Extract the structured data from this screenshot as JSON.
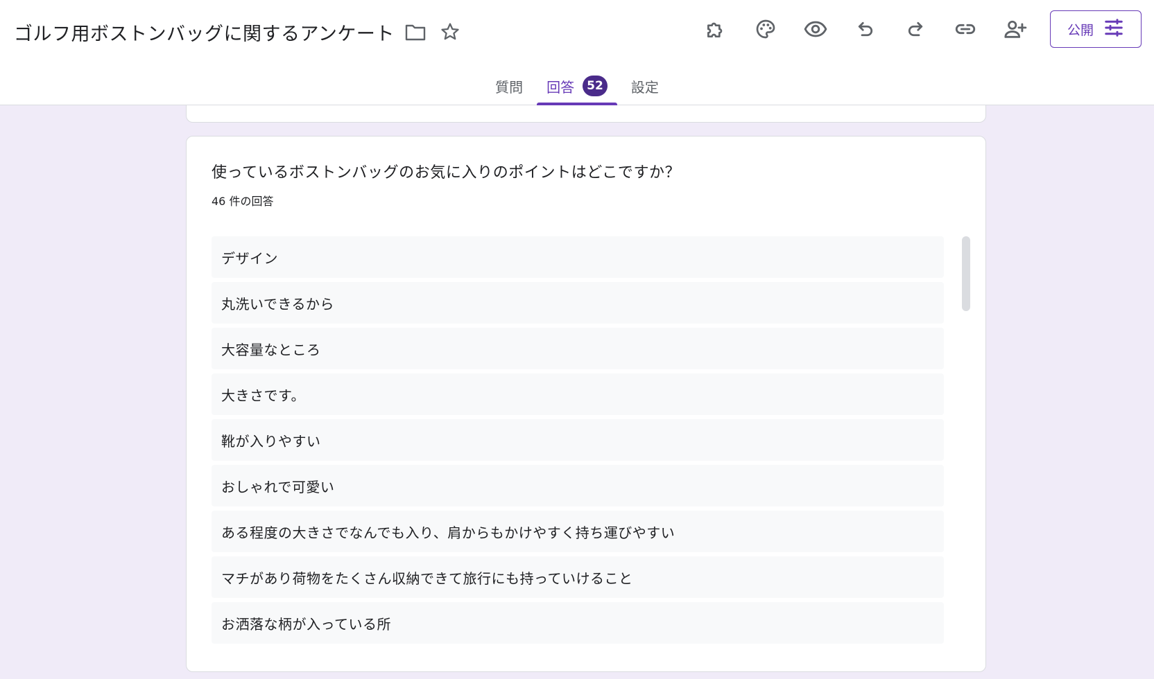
{
  "header": {
    "title": "ゴルフ用ボストンバッグに関するアンケート",
    "icons": {
      "folder": "folder-icon",
      "star": "star-icon"
    },
    "toolbar": [
      "addon-puzzle-icon",
      "palette-icon",
      "preview-eye-icon",
      "undo-icon",
      "redo-icon",
      "link-icon",
      "add-collaborator-icon"
    ],
    "publish_label": "公開",
    "publish_icon": "tune-sliders-icon"
  },
  "tabs": [
    {
      "label": "質問",
      "active": false
    },
    {
      "label": "回答",
      "active": true,
      "badge": "52"
    },
    {
      "label": "設定",
      "active": false
    }
  ],
  "question": {
    "title": "使っているボストンバッグのお気に入りのポイントはどこですか？",
    "count": "46 件の回答",
    "responses": [
      "デザイン",
      "丸洗いできるから",
      "大容量なところ",
      "大きさです。",
      "靴が入りやすい",
      "おしゃれで可愛い",
      "ある程度の大きさでなんでも入り、肩からもかけやすく持ち運びやすい",
      "マチがあり荷物をたくさん収納できて旅行にも持っていけること",
      "お洒落な柄が入っている所"
    ]
  },
  "colors": {
    "accent": "#673ab7",
    "badge": "#4a2b8a",
    "background": "#f0ebf8",
    "item_bg": "#f8f9fa",
    "icon": "#5f6368"
  }
}
